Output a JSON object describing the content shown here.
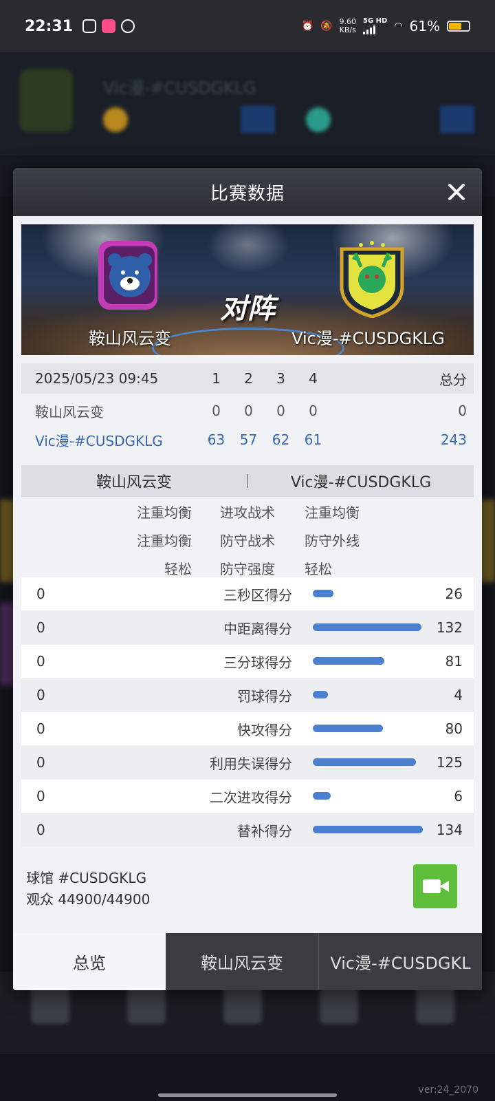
{
  "status_bar": {
    "time": "22:31",
    "speed_value": "9.60",
    "speed_unit": "KB/s",
    "network": "5G HD",
    "battery_pct": "61%",
    "battery_level": 0.61,
    "battery_color": "#f4b400"
  },
  "dialog": {
    "title": "比赛数据",
    "close_icon": "close-icon"
  },
  "matchup": {
    "vs_label": "对阵",
    "home_team": "鞍山风云变",
    "away_team": "Vic漫-#CUSDGKLG",
    "home_logo": "bear-logo",
    "away_logo": "deer-logo"
  },
  "score_table": {
    "datetime": "2025/05/23 09:45",
    "quarters": [
      "1",
      "2",
      "3",
      "4"
    ],
    "total_label": "总分",
    "rows": [
      {
        "team": "鞍山风云变",
        "q": [
          "0",
          "0",
          "0",
          "0"
        ],
        "total": "0"
      },
      {
        "team": "Vic漫-#CUSDGKLG",
        "q": [
          "63",
          "57",
          "62",
          "61"
        ],
        "total": "243"
      }
    ]
  },
  "tactics": {
    "home_header": "鞍山风云变",
    "away_header": "Vic漫-#CUSDGKLG",
    "rows": [
      {
        "home": "注重均衡",
        "label": "进攻战术",
        "away": "注重均衡"
      },
      {
        "home": "注重均衡",
        "label": "防守战术",
        "away": "防守外线"
      },
      {
        "home": "轻松",
        "label": "防守强度",
        "away": "轻松"
      }
    ]
  },
  "stats": [
    {
      "home": "0",
      "label": "三秒区得分",
      "away": "26",
      "bar_ratio": 0.19
    },
    {
      "home": "0",
      "label": "中距离得分",
      "away": "132",
      "bar_ratio": 0.985
    },
    {
      "home": "0",
      "label": "三分球得分",
      "away": "81",
      "bar_ratio": 0.65
    },
    {
      "home": "0",
      "label": "罚球得分",
      "away": "4",
      "bar_ratio": 0.14
    },
    {
      "home": "0",
      "label": "快攻得分",
      "away": "80",
      "bar_ratio": 0.64
    },
    {
      "home": "0",
      "label": "利用失误得分",
      "away": "125",
      "bar_ratio": 0.94
    },
    {
      "home": "0",
      "label": "二次进攻得分",
      "away": "6",
      "bar_ratio": 0.16
    },
    {
      "home": "0",
      "label": "替补得分",
      "away": "134",
      "bar_ratio": 1.0
    }
  ],
  "venue": {
    "arena": "球馆 #CUSDGKLG",
    "attendance": "观众 44900/44900",
    "video_icon": "video-camera-icon",
    "video_color": "#5fbf3a"
  },
  "tabs": [
    {
      "label": "总览",
      "active": true
    },
    {
      "label": "鞍山风云变",
      "active": false
    },
    {
      "label": "Vic漫-#CUSDGKL",
      "active": false
    }
  ],
  "background": {
    "team_name": "Vic漫-#CUSDGKLG",
    "version": "ver:24_2070"
  },
  "colors": {
    "bar": "#4b7fd0",
    "away_text": "#3a67b3",
    "header": "#3b3f47"
  }
}
